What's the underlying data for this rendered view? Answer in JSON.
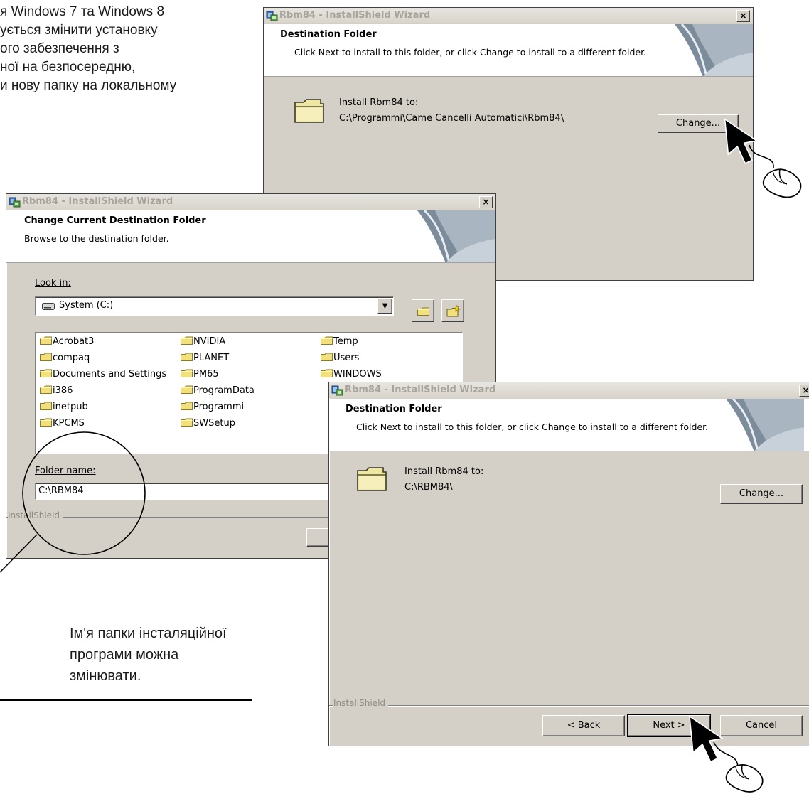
{
  "top_text": {
    "lines": [
      "я Windows 7 та Windows 8",
      "ується змінити установку",
      "ого забезпечення з",
      "ної на безпосередню,",
      "и нову папку на локальному"
    ]
  },
  "bottom_note": {
    "lines": [
      "Ім'я папки інсталяційної",
      "програми можна",
      "змінювати."
    ]
  },
  "window1": {
    "title": "Rbm84 - InstallShield Wizard",
    "close": "×",
    "header_title": "Destination Folder",
    "header_subtitle": "Click Next to install to this folder, or click Change to install to a different folder.",
    "install_label": "Install Rbm84 to:",
    "install_path": "C:\\Programmi\\Came Cancelli Automatici\\Rbm84\\",
    "change_button": "Change..."
  },
  "window2": {
    "title": "Rbm84 - InstallShield Wizard",
    "close": "×",
    "header_title": "Change Current Destination Folder",
    "header_subtitle": "Browse to the destination folder.",
    "look_in_label": "Look in:",
    "look_in_value": "System (C:)",
    "folders": [
      "Acrobat3",
      "compaq",
      "Documents and Settings",
      "i386",
      "inetpub",
      "KPCMS",
      "NVIDIA",
      "PLANET",
      "PM65",
      "ProgramData",
      "Programmi",
      "SWSetup",
      "Temp",
      "Users",
      "WINDOWS"
    ],
    "folder_name_label": "Folder name:",
    "folder_name_value": "C:\\RBM84",
    "brand": "InstallShield"
  },
  "window3": {
    "title": "Rbm84 - InstallShield Wizard",
    "close": "×",
    "header_title": "Destination Folder",
    "header_subtitle": "Click Next to install to this folder, or click Change to install to a different folder.",
    "install_label": "Install Rbm84 to:",
    "install_path": "C:\\RBM84\\",
    "change_button": "Change...",
    "brand": "InstallShield",
    "back_button": "< Back",
    "next_button": "Next >",
    "cancel_button": "Cancel"
  },
  "icons": {
    "app": "installshield-app-icon",
    "folder": "folder-icon",
    "drive": "hard-drive-icon",
    "up_folder": "up-one-level-icon",
    "new_folder": "new-folder-icon",
    "cursor": "mouse-cursor-icon",
    "mouse": "computer-mouse-icon"
  },
  "colors": {
    "dialog_bg": "#d4d0c8",
    "folder_yellow": "#f4e9a4",
    "title_text": "#a8a49c"
  }
}
